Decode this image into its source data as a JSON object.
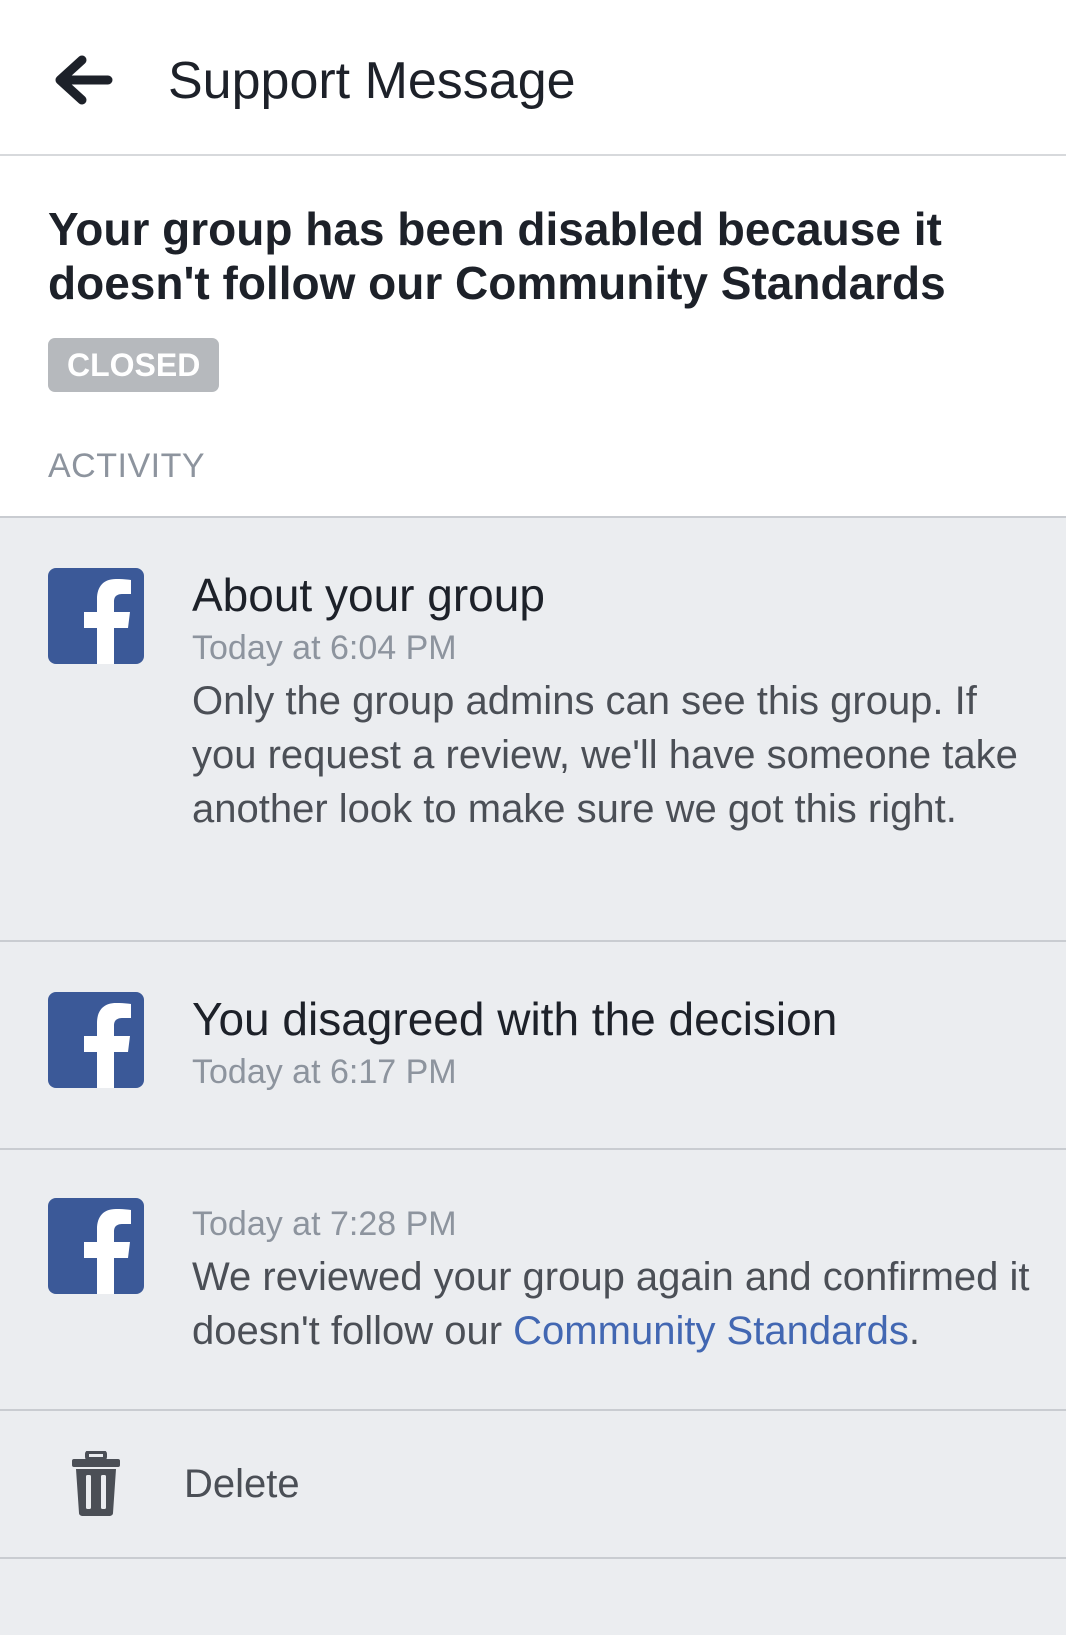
{
  "header": {
    "title": "Support Message",
    "back_icon": "back-arrow-icon"
  },
  "summary": {
    "title": "Your group has been disabled because it doesn't follow our Community Standards",
    "status": "CLOSED",
    "activity_label": "ACTIVITY"
  },
  "activity": [
    {
      "icon": "facebook-logo-icon",
      "title": "About your group",
      "time": "Today at 6:04 PM",
      "body": "Only the group admins can see this group. If you request a review, we'll have someone take another look to make sure we got this right."
    },
    {
      "icon": "facebook-logo-icon",
      "title": "You disagreed with the decision",
      "time": "Today at 6:17 PM"
    },
    {
      "icon": "facebook-logo-icon",
      "time": "Today at 7:28 PM",
      "body": "We reviewed your group again and confirmed it doesn't follow our",
      "link": "Community Standards",
      "body_end": "."
    }
  ],
  "actions": {
    "delete_label": "Delete",
    "delete_icon": "trash-icon"
  },
  "colors": {
    "facebook_blue": "#3b5998",
    "link_blue": "#4267b2",
    "badge_gray": "#b6b9bd",
    "background": "#ebedf0"
  }
}
